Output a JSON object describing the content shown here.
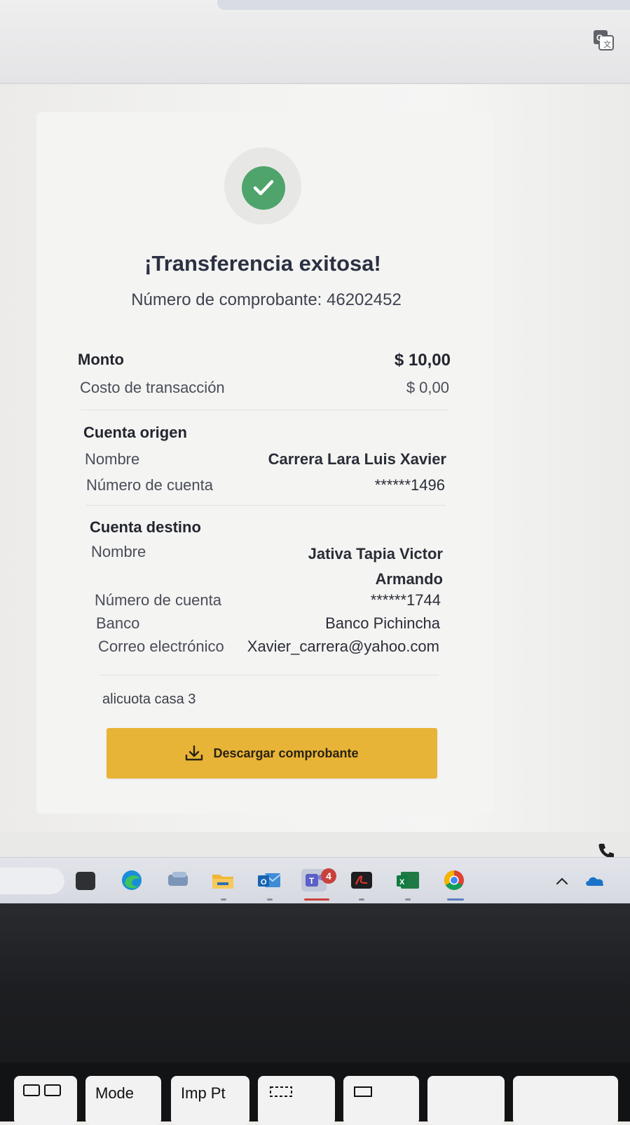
{
  "browser": {
    "translate_icon": "translate-icon"
  },
  "receipt": {
    "status_icon": "check-icon",
    "title": "¡Transferencia exitosa!",
    "voucher_text": "Número de comprobante: 46202452",
    "amount": {
      "label": "Monto",
      "value": "$ 10,00"
    },
    "fee": {
      "label": "Costo de transacción",
      "value": "$ 0,00"
    },
    "origin": {
      "title": "Cuenta origen",
      "name_label": "Nombre",
      "name_value": "Carrera Lara Luis Xavier",
      "account_label": "Número de cuenta",
      "account_value": "******1496"
    },
    "destination": {
      "title": "Cuenta destino",
      "name_label": "Nombre",
      "name_value_line1": "Jativa Tapia Victor",
      "name_value_line2": "Armando",
      "account_label": "Número de cuenta",
      "account_value": "******1744",
      "bank_label": "Banco",
      "bank_value": "Banco Pichincha",
      "email_label": "Correo electrónico",
      "email_value": "Xavier_carrera@yahoo.com"
    },
    "note": "alicuota casa 3",
    "download_label": "Descargar comprobante",
    "download_icon": "download-icon"
  },
  "taskbar": {
    "teams_badge": "4",
    "icons": [
      "file-explorer-icon",
      "edge-icon",
      "chat-icon",
      "folder-icon",
      "outlook-icon",
      "teams-icon",
      "acrobat-icon",
      "excel-icon",
      "chrome-icon"
    ],
    "tray_icons": [
      "chevron-up-icon",
      "onedrive-icon"
    ],
    "phone_icon": "phone-icon",
    "colors": {
      "success": "#4ea46a",
      "button": "#e8b437"
    }
  },
  "keyboard": {
    "key_mode": "Mode",
    "key_print": "Imp Pt"
  }
}
